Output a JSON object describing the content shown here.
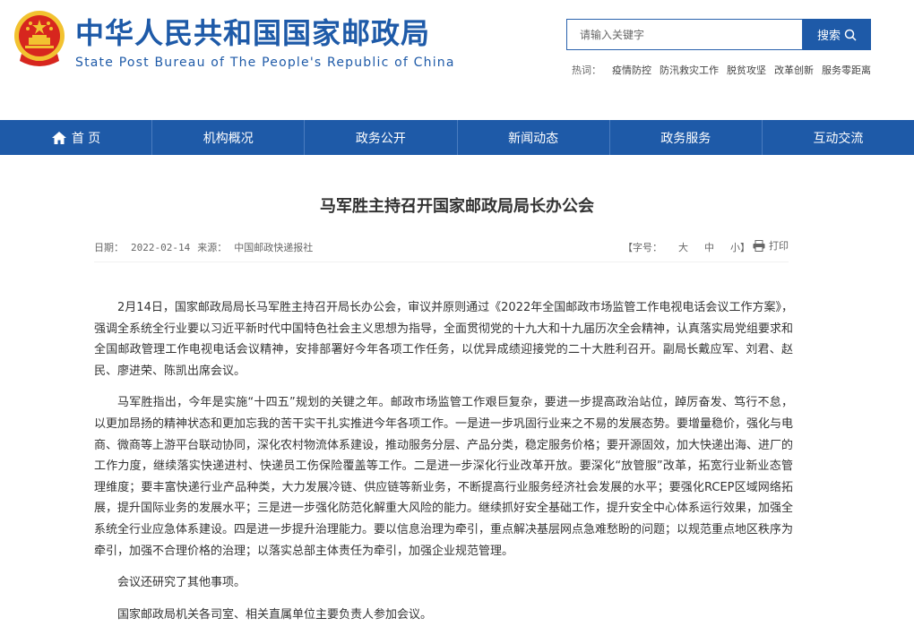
{
  "header": {
    "title_cn": "中华人民共和国国家邮政局",
    "title_en": "State Post Bureau of The People's Republic of China"
  },
  "search": {
    "placeholder": "请输入关键字",
    "button_label": "搜索"
  },
  "hot": {
    "label": "热词：",
    "items": [
      "疫情防控",
      "防汛救灾工作",
      "脱贫攻坚",
      "改革创新",
      "服务零距离"
    ]
  },
  "nav": {
    "items": [
      "首 页",
      "机构概况",
      "政务公开",
      "新闻动态",
      "政务服务",
      "互动交流"
    ]
  },
  "article": {
    "title": "马军胜主持召开国家邮政局局长办公会",
    "date_label": "日期：",
    "date": "2022-02-14",
    "source_label": "来源：",
    "source": "中国邮政快递报社",
    "font_size_label": "【字号：",
    "font_large": "大",
    "font_medium": "中",
    "font_small": "小】",
    "print_label": "打印",
    "paragraphs": [
      "2月14日，国家邮政局局长马军胜主持召开局长办公会，审议并原则通过《2022年全国邮政市场监管工作电视电话会议工作方案》，强调全系统全行业要以习近平新时代中国特色社会主义思想为指导，全面贯彻党的十九大和十九届历次全会精神，认真落实局党组要求和全国邮政管理工作电视电话会议精神，安排部署好今年各项工作任务，以优异成绩迎接党的二十大胜利召开。副局长戴应军、刘君、赵民、廖进荣、陈凯出席会议。",
      "马军胜指出，今年是实施“十四五”规划的关键之年。邮政市场监管工作艰巨复杂，要进一步提高政治站位，踔厉奋发、笃行不怠，以更加昂扬的精神状态和更加忘我的苦干实干扎实推进今年各项工作。一是进一步巩固行业来之不易的发展态势。要增量稳价，强化与电商、微商等上游平台联动协同，深化农村物流体系建设，推动服务分层、产品分类，稳定服务价格；要开源固效，加大快递出海、进厂的工作力度，继续落实快递进村、快递员工伤保险覆盖等工作。二是进一步深化行业改革开放。要深化“放管服”改革，拓宽行业新业态管理维度；要丰富快递行业产品种类，大力发展冷链、供应链等新业务，不断提高行业服务经济社会发展的水平；要强化RCEP区域网络拓展，提升国际业务的发展水平；三是进一步强化防范化解重大风险的能力。继续抓好安全基础工作，提升安全中心体系运行效果，加强全系统全行业应急体系建设。四是进一步提升治理能力。要以信息治理为牵引，重点解决基层网点急难愁盼的问题；以规范重点地区秩序为牵引，加强不合理价格的治理；以落实总部主体责任为牵引，加强企业规范管理。",
      "会议还研究了其他事项。",
      "国家邮政局机关各司室、相关直属单位主要负责人参加会议。"
    ]
  },
  "colors": {
    "brand_blue": "#1e5aa8",
    "emblem_red": "#d7261e",
    "emblem_gold": "#f2c230"
  }
}
